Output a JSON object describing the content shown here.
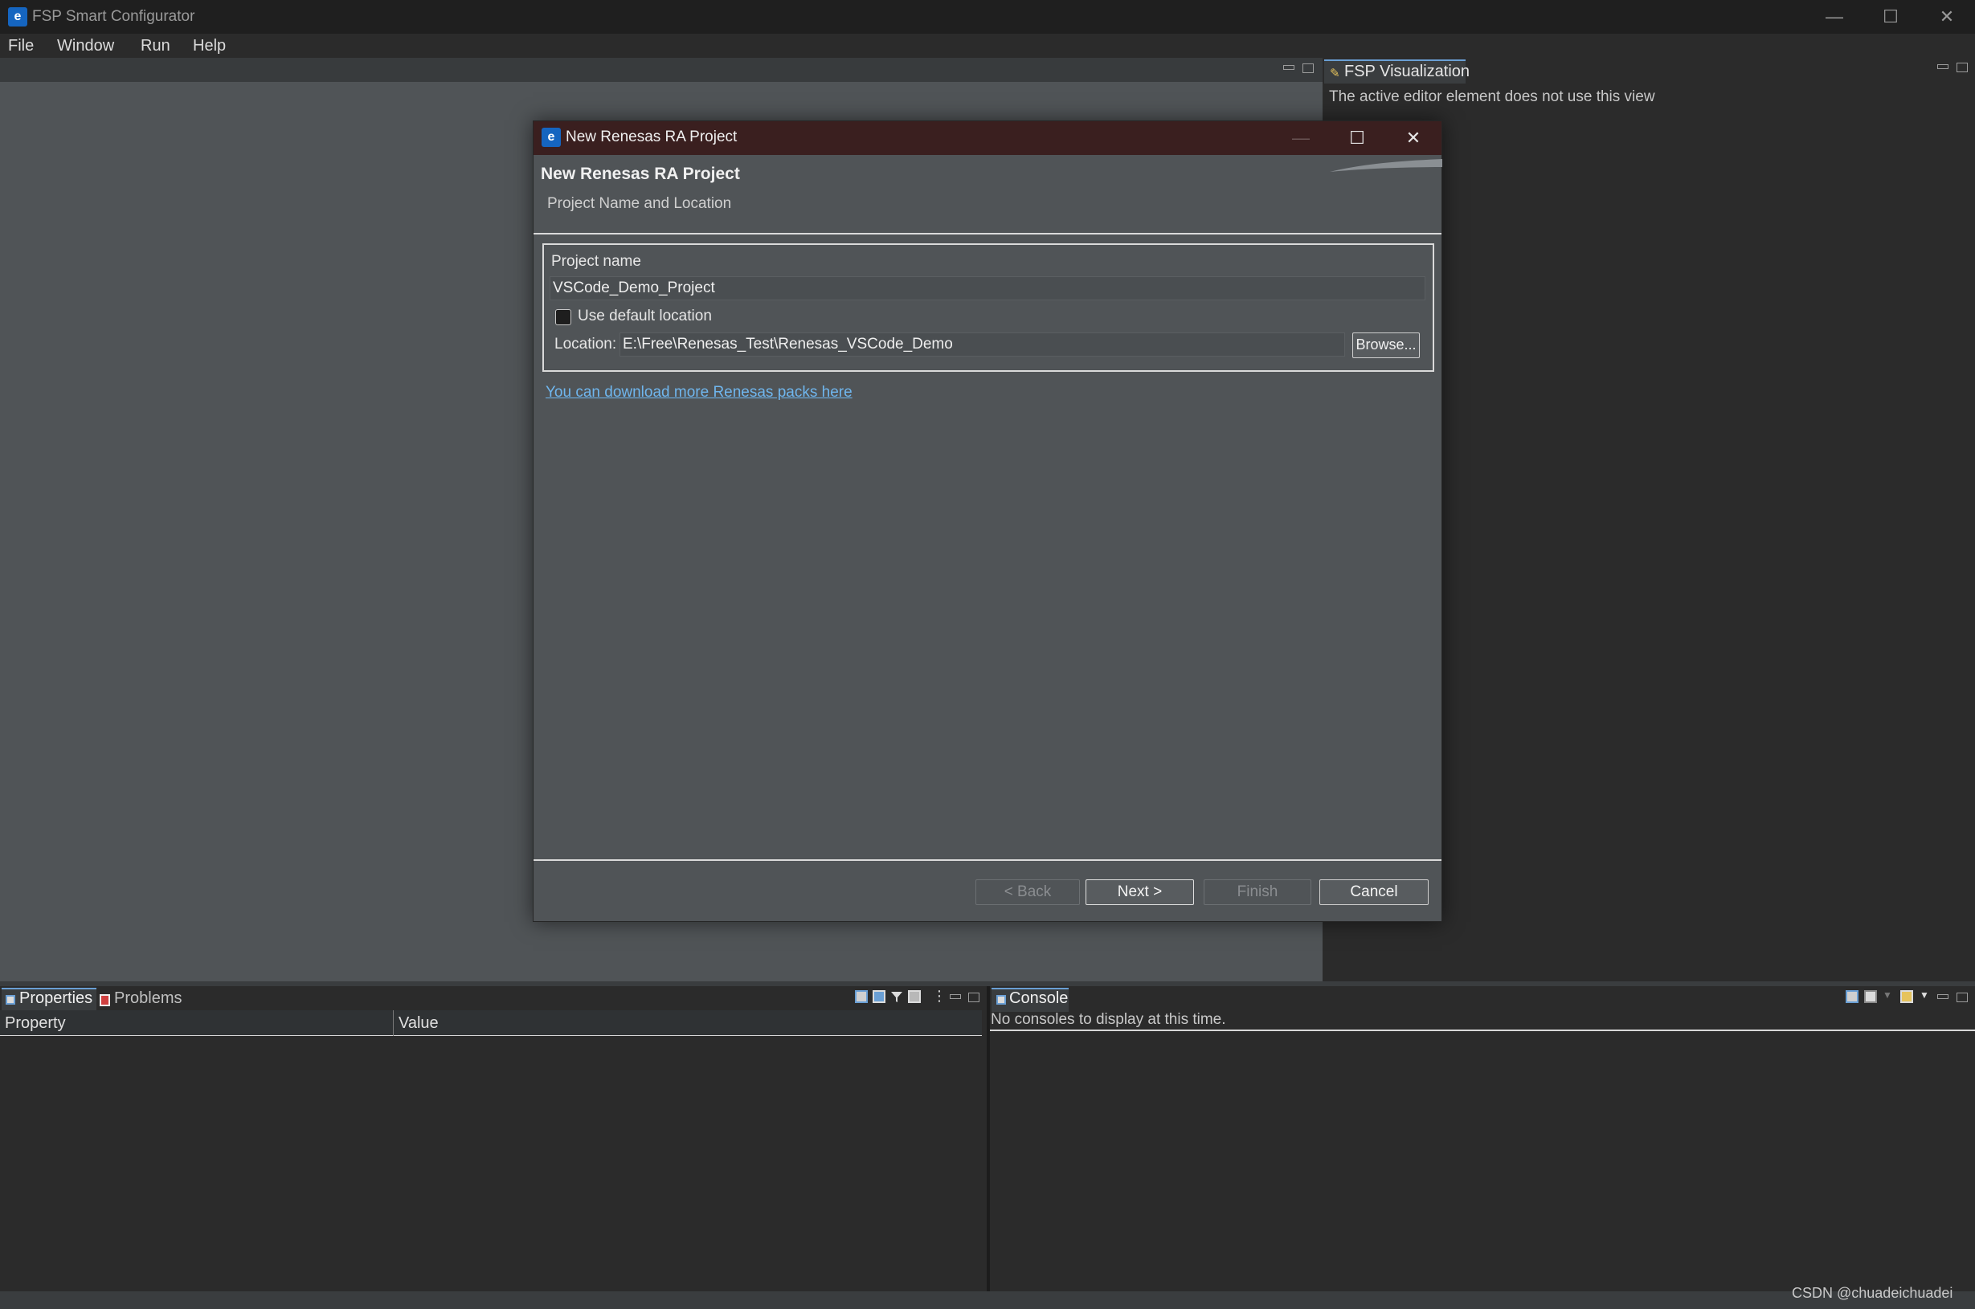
{
  "app": {
    "title": "FSP Smart Configurator",
    "window_controls": {
      "minimize": "—",
      "maximize": "☐",
      "close": "✕"
    }
  },
  "menu": [
    "File",
    "Window",
    "Run",
    "Help"
  ],
  "viz_panel": {
    "tab_label": "FSP Visualization",
    "message": "The active editor element does not use this view"
  },
  "dialog": {
    "title": "New Renesas RA Project",
    "banner_title": "New Renesas RA Project",
    "banner_subtitle": "Project Name and Location",
    "project_name_label": "Project name",
    "project_name_value": "VSCode_Demo_Project",
    "use_default_location_label": "Use default location",
    "use_default_location_checked": false,
    "location_label": "Location:",
    "location_value": "E:\\Free\\Renesas_Test\\Renesas_VSCode_Demo",
    "browse_label": "Browse...",
    "download_link": "You can download more Renesas packs here",
    "buttons": {
      "back": "< Back",
      "next": "Next >",
      "finish": "Finish",
      "cancel": "Cancel"
    }
  },
  "properties_panel": {
    "tabs": [
      "Properties",
      "Problems"
    ],
    "columns": [
      "Property",
      "Value"
    ]
  },
  "console_panel": {
    "tab_label": "Console",
    "message": "No consoles to display at this time."
  },
  "watermark": "CSDN @chuadeichuadei",
  "colors": {
    "accent": "#6a9fd4",
    "link": "#6fb6ee",
    "dialog_titlebar": "#3a1f1f",
    "editor_bg": "#505457"
  }
}
